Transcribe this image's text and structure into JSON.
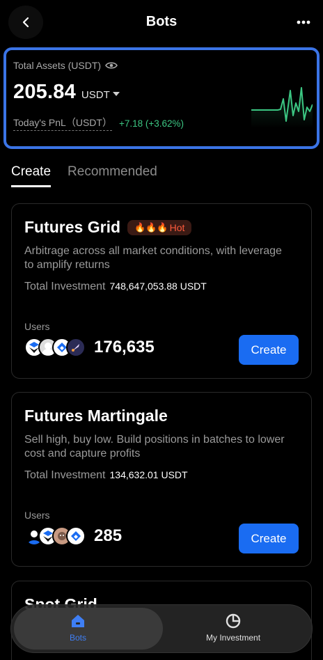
{
  "header": {
    "title": "Bots"
  },
  "assets": {
    "label": "Total Assets (USDT)",
    "value": "205.84",
    "unit": "USDT",
    "pnl_label": "Today's PnL（USDT）",
    "pnl_value": "+7.18 (+3.62%)"
  },
  "tabs": [
    {
      "label": "Create",
      "active": true
    },
    {
      "label": "Recommended",
      "active": false
    }
  ],
  "bots": [
    {
      "name": "Futures Grid",
      "badge": "Hot",
      "badge_icons": "🔥🔥🔥",
      "description": "Arbitrage across all market conditions, with leverage to amplify returns",
      "investment_label": "Total Investment",
      "investment_value": "748,647,053.88 USDT",
      "users_label": "Users",
      "users_count": "176,635",
      "button": "Create"
    },
    {
      "name": "Futures Martingale",
      "description": "Sell high, buy low. Build positions in batches to lower cost and capture profits",
      "investment_label": "Total Investment",
      "investment_value": "134,632.01 USDT",
      "users_label": "Users",
      "users_count": "285",
      "button": "Create"
    },
    {
      "name": "Spot Grid"
    }
  ],
  "nav": {
    "bots_label": "Bots",
    "investment_label": "My Investment"
  },
  "colors": {
    "accent": "#1a6cf2",
    "positive": "#3cc783",
    "hot": "#ff5a3c"
  }
}
